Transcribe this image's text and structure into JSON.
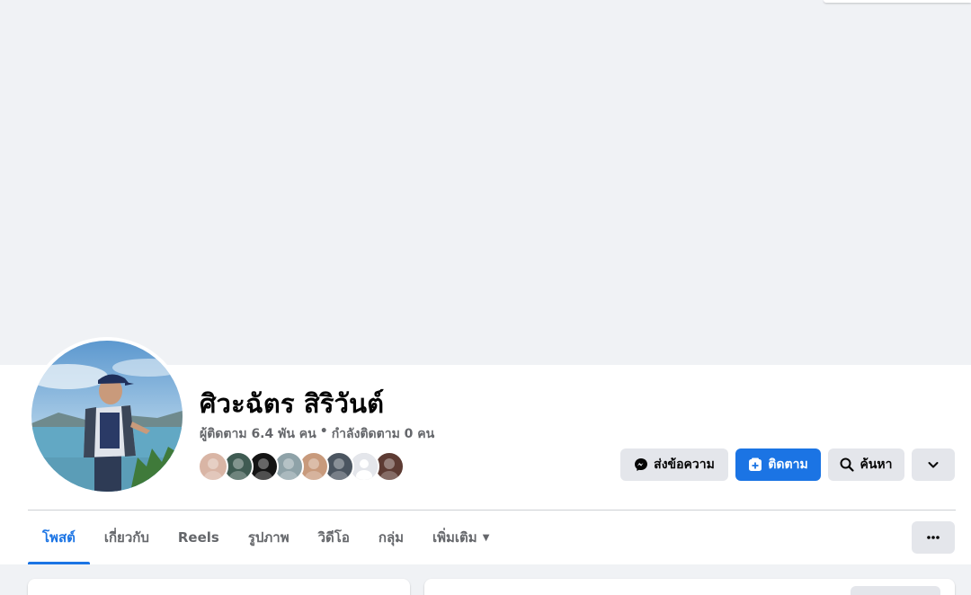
{
  "profile": {
    "name": "ศิวะฉัตร สิริวันต์",
    "followers": "ผู้ติดตาม 6.4 พัน คน",
    "separator": "•",
    "following": "กำลังติดตาม 0 คน"
  },
  "actions": {
    "message_label": "ส่งข้อความ",
    "follow_label": "ติดตาม",
    "search_label": "ค้นหา"
  },
  "tabs": [
    {
      "label": "โพสต์",
      "active": true
    },
    {
      "label": "เกี่ยวกับ",
      "active": false
    },
    {
      "label": "Reels",
      "active": false
    },
    {
      "label": "รูปภาพ",
      "active": false
    },
    {
      "label": "วิดีโอ",
      "active": false
    },
    {
      "label": "กลุ่ม",
      "active": false
    },
    {
      "label": "เพิ่มเติม",
      "active": false
    }
  ],
  "friends": [
    {
      "icon": "friend-avatar",
      "color": "#d9b5a5"
    },
    {
      "icon": "friend-avatar",
      "color": "#3f5b52"
    },
    {
      "icon": "friend-avatar",
      "color": "#141414"
    },
    {
      "icon": "friend-avatar",
      "color": "#8ea2a8"
    },
    {
      "icon": "friend-avatar",
      "color": "#c89a7c"
    },
    {
      "icon": "friend-avatar",
      "color": "#4b5560"
    },
    {
      "icon": "default-avatar",
      "color": "#c9ccd1"
    },
    {
      "icon": "friend-avatar",
      "color": "#5d3b33"
    }
  ],
  "colors": {
    "accent": "#1b74e4",
    "secondary_text": "#65676b",
    "button_gray": "#e4e6eb",
    "page_bg": "#f0f2f5"
  }
}
